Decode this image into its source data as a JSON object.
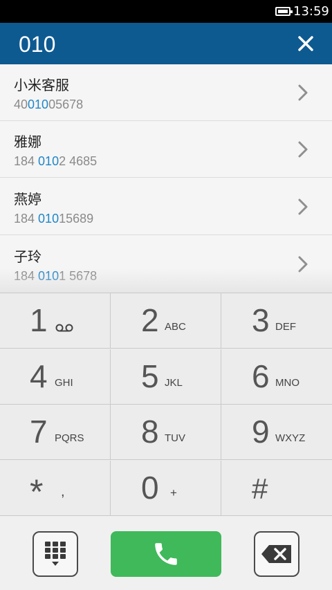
{
  "status_bar": {
    "time": "13:59"
  },
  "header": {
    "dialed_number": "010"
  },
  "results": [
    {
      "name": "小米客服",
      "number_pre": "40",
      "number_match": "010",
      "number_post": "05678"
    },
    {
      "name": "雅娜",
      "number_pre": "184 ",
      "number_match": "010",
      "number_post": "2 4685"
    },
    {
      "name": "燕婷",
      "number_pre": "184 ",
      "number_match": "010",
      "number_post": "15689"
    },
    {
      "name": "子玲",
      "number_pre": "184 ",
      "number_match": "010",
      "number_post": "1 5678"
    }
  ],
  "keypad": [
    {
      "digit": "1",
      "letters": ""
    },
    {
      "digit": "2",
      "letters": "ABC"
    },
    {
      "digit": "3",
      "letters": "DEF"
    },
    {
      "digit": "4",
      "letters": "GHI"
    },
    {
      "digit": "5",
      "letters": "JKL"
    },
    {
      "digit": "6",
      "letters": "MNO"
    },
    {
      "digit": "7",
      "letters": "PQRS"
    },
    {
      "digit": "8",
      "letters": "TUV"
    },
    {
      "digit": "9",
      "letters": "WXYZ"
    },
    {
      "digit": "*",
      "letters": ","
    },
    {
      "digit": "0",
      "letters": "+"
    },
    {
      "digit": "#",
      "letters": ""
    }
  ],
  "icons": {
    "close": "close-icon",
    "chevron": "chevron-right-icon",
    "voicemail": "voicemail-icon",
    "keyboard": "dialpad-toggle-icon",
    "call": "phone-icon",
    "backspace": "backspace-icon",
    "battery": "battery-icon"
  },
  "colors": {
    "header_bg": "#0d5a91",
    "match_highlight": "#1f86c9",
    "call_button": "#3fb95a"
  }
}
